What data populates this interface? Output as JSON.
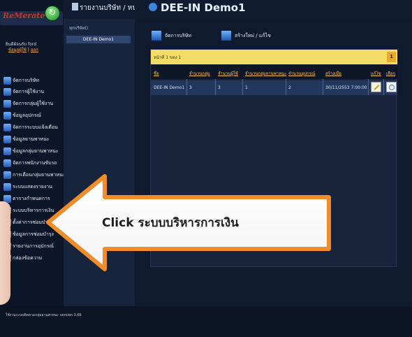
{
  "sidebar": {
    "logo_text": "ReMerate",
    "user_name": "ยินดีต้อนรับ ford",
    "link_profile": "ข้อมูลผู้ใช้",
    "link_separator": "|",
    "link_logout": "ออก",
    "items": [
      {
        "label": "จัดการบริษัท",
        "icon": "company-icon"
      },
      {
        "label": "จัดการผู้ใช้งาน",
        "icon": "user-icon"
      },
      {
        "label": "จัดการกลุ่มผู้ใช้งาน",
        "icon": "users-icon"
      },
      {
        "label": "ข้อมูลอุปกรณ์",
        "icon": "device-icon"
      },
      {
        "label": "จัดการระบบแจ้งเตือน",
        "icon": "alert-icon"
      },
      {
        "label": "ข้อมูลยานพาหนะ",
        "icon": "vehicle-icon"
      },
      {
        "label": "ข้อมูลกลุ่มยานพาหนะ",
        "icon": "vehicle-group-icon"
      },
      {
        "label": "จัดการพนักงานขับรถ",
        "icon": "driver-icon"
      },
      {
        "label": "การเตือนกลุ่มยานพาหนะ",
        "icon": "warning-icon"
      },
      {
        "label": "ระบบแสดงรายงาน",
        "icon": "report-icon"
      },
      {
        "label": "ตารางกำหนดการ",
        "icon": "calendar-icon"
      },
      {
        "label": "ระบบบริหารการเงิน",
        "icon": "finance-icon"
      },
      {
        "label": "ตั้งค่าการซ่อมบำรุง",
        "icon": "wrench-icon"
      },
      {
        "label": "ข้อมูลการซ่อมบำรุง",
        "icon": "maintenance-icon"
      },
      {
        "label": "รายงานการอุปกรณ์",
        "icon": "device-report-icon"
      },
      {
        "label": "กล่องข้อความ",
        "icon": "inbox-icon"
      }
    ]
  },
  "col2": {
    "title": "รายงานบริษัท / หน่วยงาน",
    "breadcrumb": "ทุกบริษัท()",
    "org_item": "DEE-IN Demo1"
  },
  "main": {
    "title": "DEE-IN Demo1",
    "btn_manage": "จัดการบริษัท",
    "btn_create": "สร้างใหม่ / แก้ไข",
    "pager_text": "หน้าที่ 1 ของ 1",
    "pager_page": "1",
    "columns": [
      "ชื่อ",
      "จำนวนกลุ่ม",
      "จำนวนผู้ใช้",
      "จำนวนกลุ่มยานพาหนะ",
      "จำนวนอุปกรณ์",
      "สร้างเมื่อ",
      "แก้ไข",
      "เลือก"
    ],
    "row": [
      "DEE-IN Demo1",
      "3",
      "3",
      "1",
      "2",
      "30/11/2553 7:00:00"
    ]
  },
  "footer": {
    "text": "ใช้งานระบบติดตามกลุ่มยานพาหนะ version 3.65"
  },
  "callout": {
    "prefix": "Click",
    "text": "ระบบบริหารการเงิน"
  },
  "colors": {
    "accent": "#f4dd66",
    "callout_orange": "#f28c28"
  }
}
